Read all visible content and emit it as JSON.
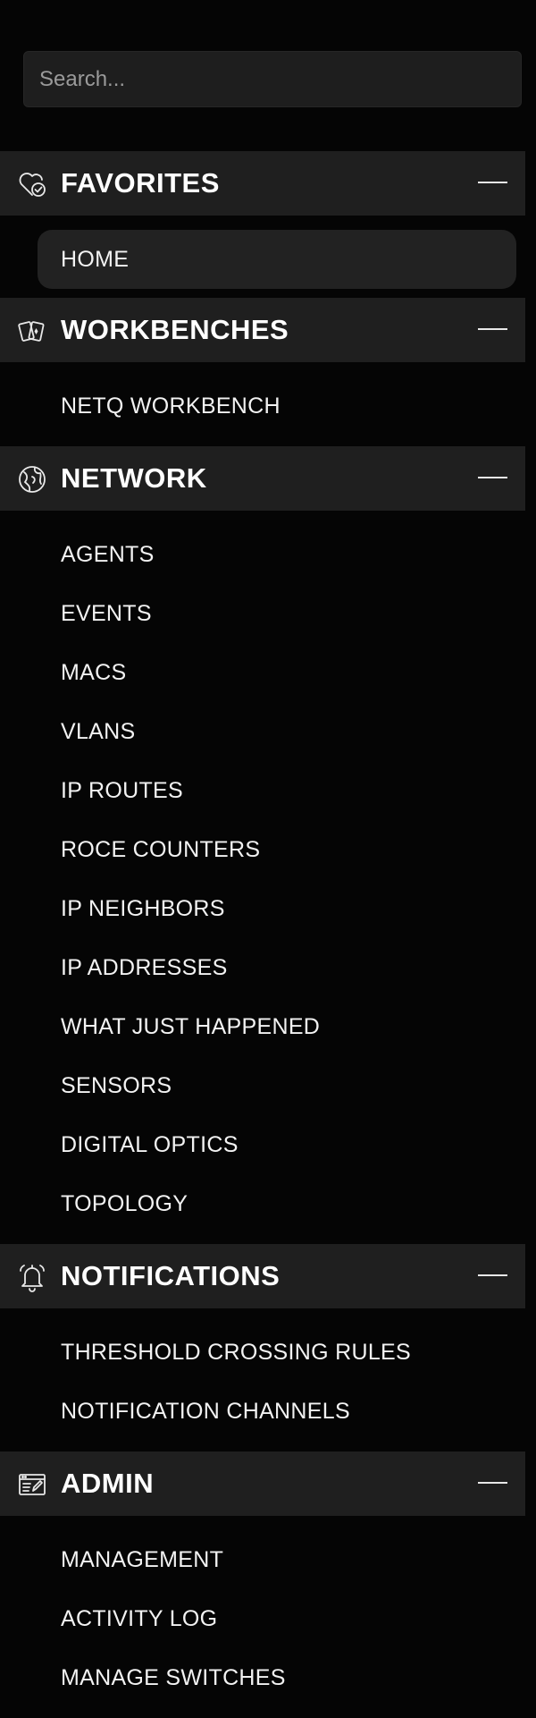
{
  "search": {
    "placeholder": "Search..."
  },
  "sections": [
    {
      "title": "FAVORITES",
      "icon": "heart-check-icon",
      "items": [
        {
          "label": "HOME",
          "active": true
        }
      ]
    },
    {
      "title": "WORKBENCHES",
      "icon": "cards-icon",
      "items": [
        {
          "label": "NETQ WORKBENCH"
        }
      ]
    },
    {
      "title": "NETWORK",
      "icon": "globe-icon",
      "items": [
        {
          "label": "AGENTS"
        },
        {
          "label": "EVENTS"
        },
        {
          "label": "MACS"
        },
        {
          "label": "VLANS"
        },
        {
          "label": "IP ROUTES"
        },
        {
          "label": "ROCE COUNTERS"
        },
        {
          "label": "IP NEIGHBORS"
        },
        {
          "label": "IP ADDRESSES"
        },
        {
          "label": "WHAT JUST HAPPENED"
        },
        {
          "label": "SENSORS"
        },
        {
          "label": "DIGITAL OPTICS"
        },
        {
          "label": "TOPOLOGY"
        }
      ]
    },
    {
      "title": "NOTIFICATIONS",
      "icon": "bell-icon",
      "items": [
        {
          "label": "THRESHOLD CROSSING RULES"
        },
        {
          "label": "NOTIFICATION CHANNELS"
        }
      ]
    },
    {
      "title": "ADMIN",
      "icon": "admin-window-icon",
      "items": [
        {
          "label": "MANAGEMENT"
        },
        {
          "label": "ACTIVITY LOG"
        },
        {
          "label": "MANAGE SWITCHES"
        }
      ]
    }
  ],
  "colors": {
    "background": "#050505",
    "header_bg": "#1f1f1f",
    "active_item_bg": "#222222",
    "search_bg": "#1e1e1e"
  }
}
